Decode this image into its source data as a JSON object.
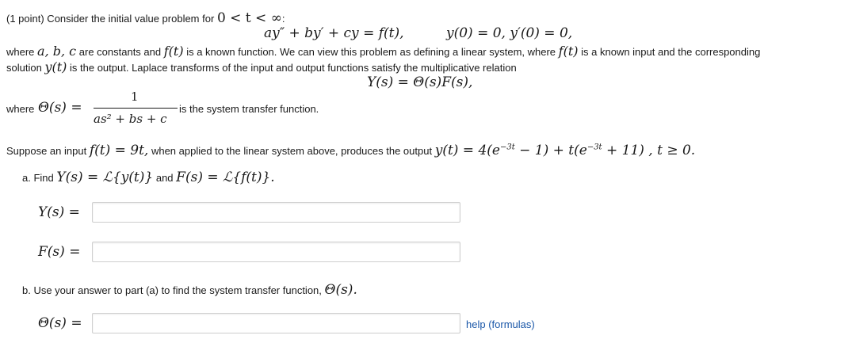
{
  "intro": {
    "prefix": "(1 point) Consider the initial value problem for",
    "domain": "0 < t < ∞",
    "suffix": ":"
  },
  "eq1": {
    "ode": "ay″ + by′ + cy = f(t),",
    "ics": "y(0) = 0,    y′(0) = 0,"
  },
  "para1": {
    "l1a": "where",
    "l1b": "a, b, c",
    "l1c": "are constants and",
    "l1d": "f(t)",
    "l1e": "is a known function. We can view this problem as defining a linear system, where",
    "l1f": "f(t)",
    "l1g": "is a known input and the corresponding",
    "l2a": "solution",
    "l2b": "y(t)",
    "l2c": "is the output. Laplace transforms of the input and output functions satisfy the multiplicative relation"
  },
  "eq2": "Y(s) = Θ(s)F(s),",
  "transfer": {
    "where": "where",
    "theta": "Θ(s) =",
    "numerator": "1",
    "denominator": "as² + bs + c",
    "suffix": "is the system transfer function."
  },
  "suppose": {
    "a": "Suppose an input",
    "f": "f(t) = 9t,",
    "b": "when applied to the linear system above, produces the output",
    "y": "y(t) = 4(e",
    "exp1": "−3t",
    "y2": " − 1) + t(e",
    "exp2": "−3t",
    "y3": " + 11) ,  t ≥ 0."
  },
  "partA": {
    "label": "a. Find",
    "expr1": "Y(s) = ℒ{y(t)}",
    "and": "and",
    "expr2": "F(s) = ℒ{f(t)}."
  },
  "fields": {
    "y_label": "Y(s) =",
    "f_label": "F(s) =",
    "theta_label": "Θ(s) =",
    "y_value": "",
    "f_value": "",
    "theta_value": ""
  },
  "partB": {
    "text": "b. Use your answer to part (a) to find the system transfer function,",
    "expr": "Θ(s)."
  },
  "help": "help (formulas)"
}
